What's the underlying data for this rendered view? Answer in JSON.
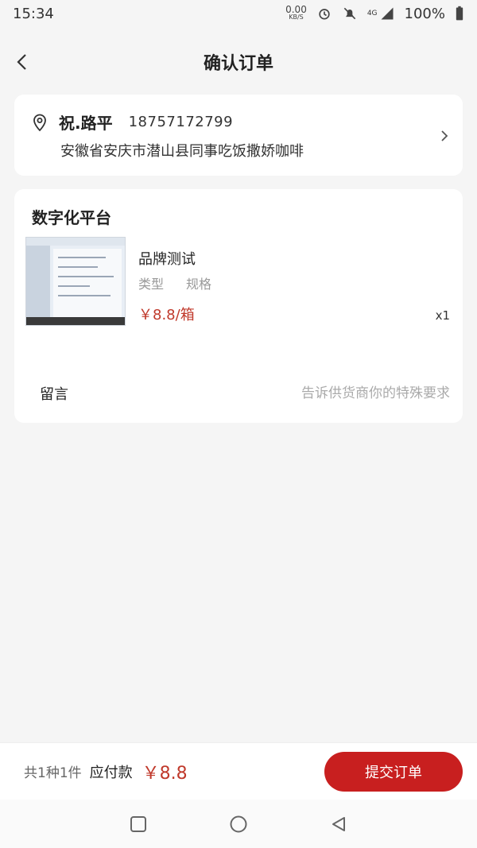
{
  "status_bar": {
    "time": "15:34",
    "net_speed_value": "0.00",
    "net_speed_unit": "KB/S",
    "network": "4G",
    "battery": "100%"
  },
  "header": {
    "title": "确认订单"
  },
  "address": {
    "name": "祝.路平",
    "phone": "18757172799",
    "detail": "安徽省安庆市潜山县同事吃饭撒娇咖啡"
  },
  "order": {
    "shop_name": "数字化平台",
    "product": {
      "title": "品牌测试",
      "meta_type": "类型",
      "meta_spec": "规格",
      "price": "￥8.8/箱",
      "quantity": "x1"
    },
    "message": {
      "label": "留言",
      "placeholder": "告诉供货商你的特殊要求"
    }
  },
  "footer": {
    "total_count": "共1种1件",
    "pay_label": "应付款",
    "pay_amount": "￥8.8",
    "submit_label": "提交订单"
  },
  "colors": {
    "accent": "#c81f1f",
    "price": "#c0392b",
    "background": "#f5f5f5"
  }
}
